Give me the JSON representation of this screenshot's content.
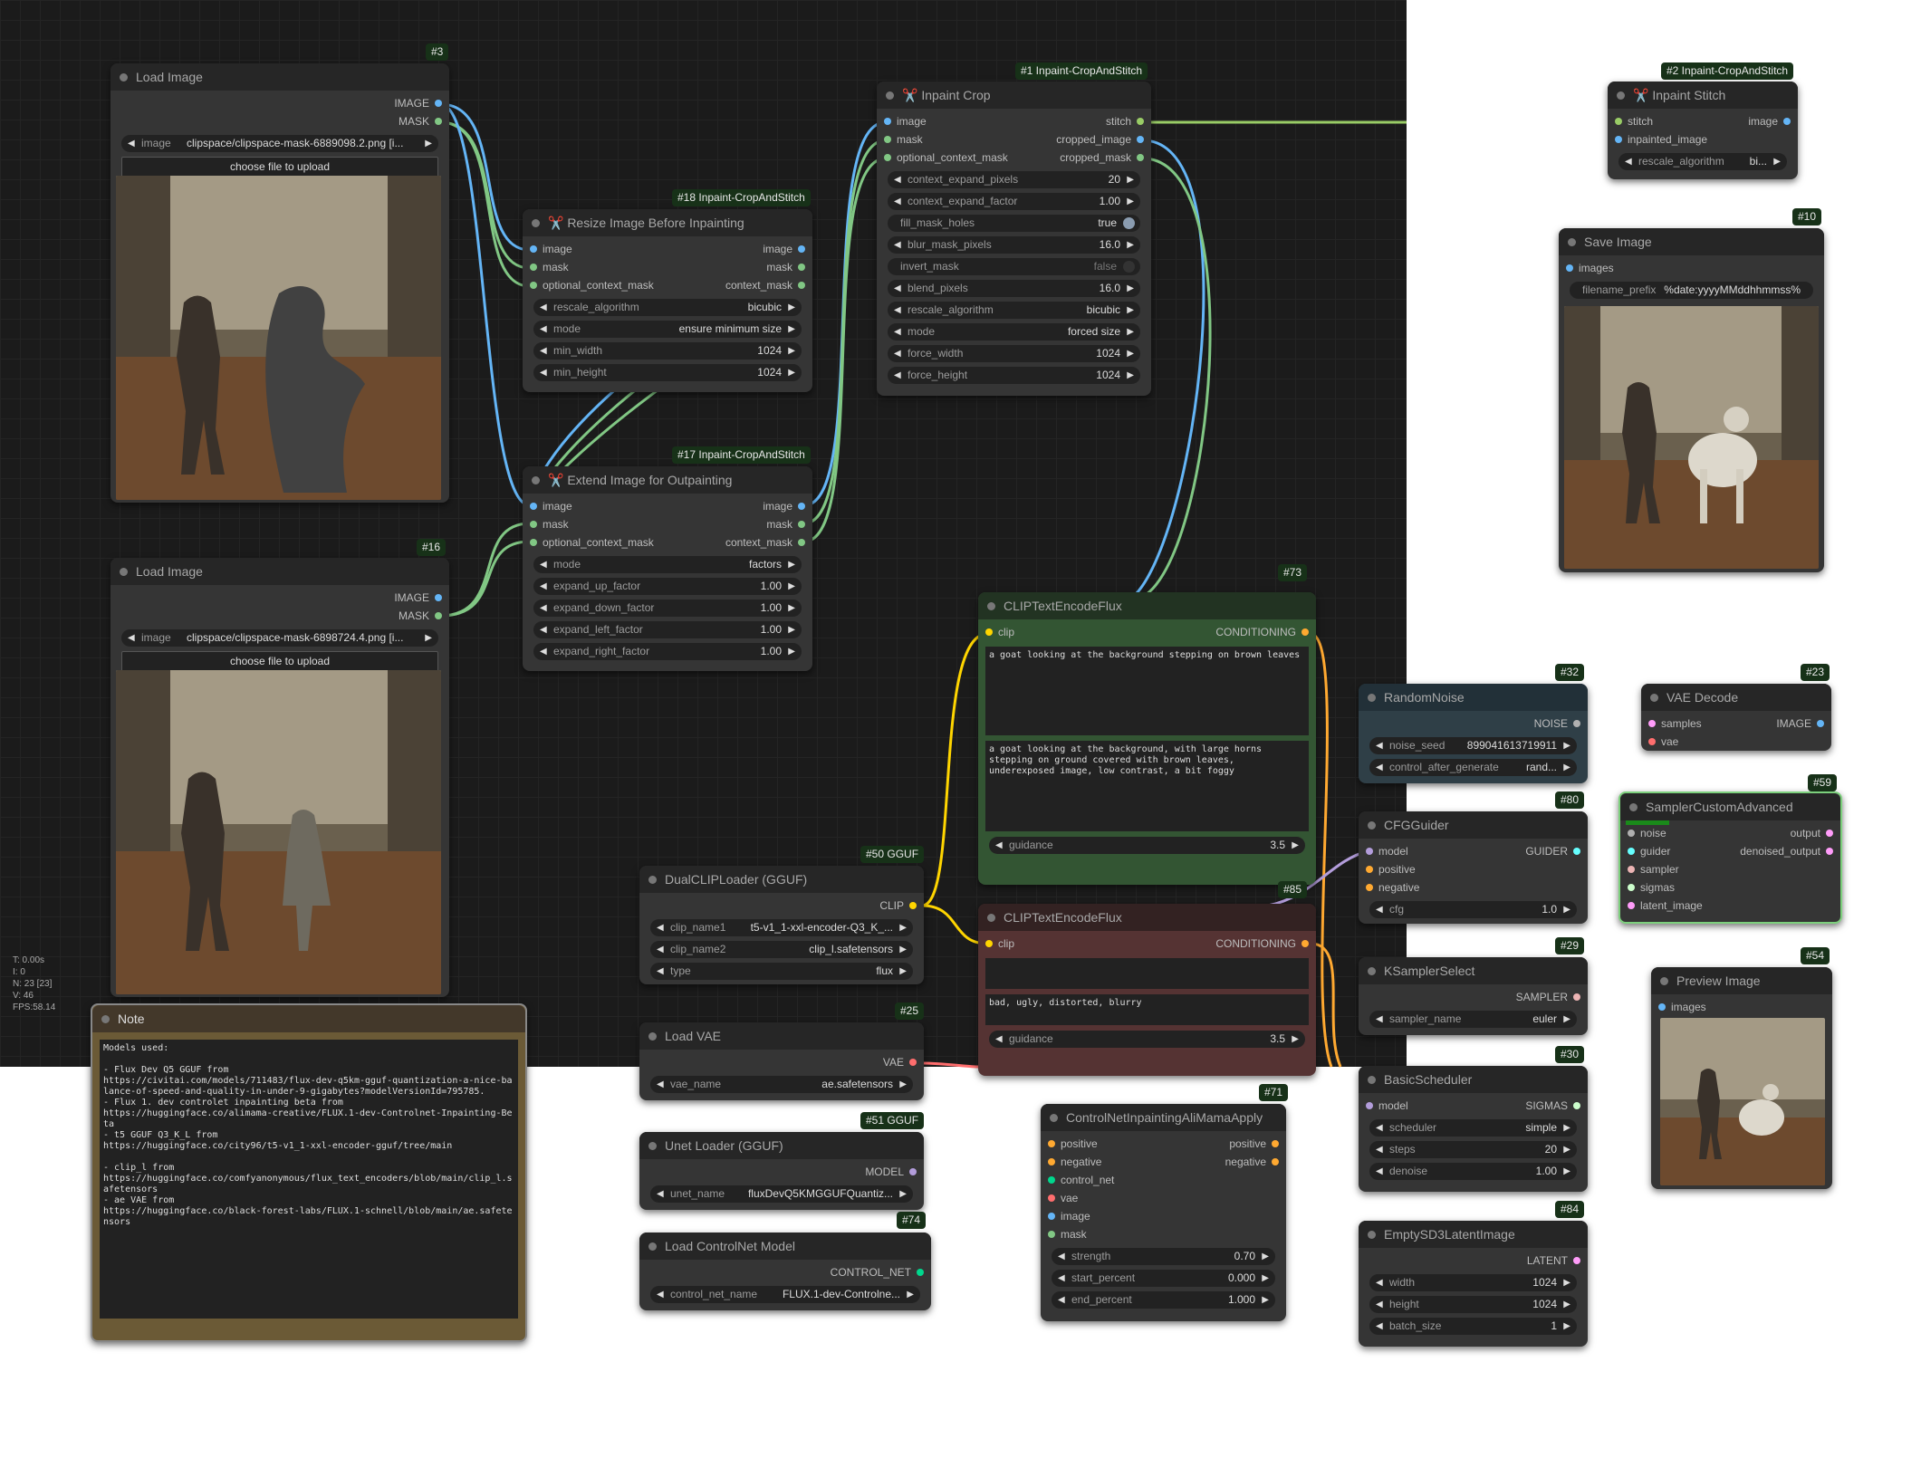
{
  "colors": {
    "image": "#64b5f6",
    "mask": "#81c784",
    "clip": "#ffd500",
    "conditioning": "#ffa931",
    "latent": "#ff9cf9",
    "vae": "#ff6e6e",
    "model": "#b39ddb",
    "control_net": "#00d78d",
    "badge_bg": "#173118"
  },
  "stats": [
    "T: 0.00s",
    "I: 0",
    "N: 23 [23]",
    "V: 46",
    "FPS:58.14"
  ],
  "nodes": {
    "load_image_3": {
      "badge": "#3",
      "title": "Load Image",
      "out1": "IMAGE",
      "out2": "MASK",
      "image_label": "image",
      "image_value": "clipspace/clipspace-mask-6889098.2.png [i...",
      "button": "choose file to upload"
    },
    "load_image_16": {
      "badge": "#16",
      "title": "Load Image",
      "out1": "IMAGE",
      "out2": "MASK",
      "image_label": "image",
      "image_value": "clipspace/clipspace-mask-6898724.4.png [i...",
      "button": "choose file to upload"
    },
    "resize_18": {
      "badge": "#18 Inpaint-CropAndStitch",
      "title": "✂️ Resize Image Before Inpainting",
      "in1": "image",
      "in2": "mask",
      "in3": "optional_context_mask",
      "out1": "image",
      "out2": "mask",
      "out3": "context_mask",
      "w1l": "rescale_algorithm",
      "w1v": "bicubic",
      "w2l": "mode",
      "w2v": "ensure minimum size",
      "w3l": "min_width",
      "w3v": "1024",
      "w4l": "min_height",
      "w4v": "1024"
    },
    "extend_17": {
      "badge": "#17 Inpaint-CropAndStitch",
      "title": "✂️ Extend Image for Outpainting",
      "in1": "image",
      "in2": "mask",
      "in3": "optional_context_mask",
      "out1": "image",
      "out2": "mask",
      "out3": "context_mask",
      "w1l": "mode",
      "w1v": "factors",
      "w2l": "expand_up_factor",
      "w2v": "1.00",
      "w3l": "expand_down_factor",
      "w3v": "1.00",
      "w4l": "expand_left_factor",
      "w4v": "1.00",
      "w5l": "expand_right_factor",
      "w5v": "1.00"
    },
    "crop_1": {
      "badge": "#1 Inpaint-CropAndStitch",
      "title": "✂️ Inpaint Crop",
      "in1": "image",
      "in2": "mask",
      "in3": "optional_context_mask",
      "out1": "stitch",
      "out2": "cropped_image",
      "out3": "cropped_mask",
      "w1l": "context_expand_pixels",
      "w1v": "20",
      "w2l": "context_expand_factor",
      "w2v": "1.00",
      "w3l": "fill_mask_holes",
      "w3v": "true",
      "w4l": "blur_mask_pixels",
      "w4v": "16.0",
      "w5l": "invert_mask",
      "w5v": "false",
      "w6l": "blend_pixels",
      "w6v": "16.0",
      "w7l": "rescale_algorithm",
      "w7v": "bicubic",
      "w8l": "mode",
      "w8v": "forced size",
      "w9l": "force_width",
      "w9v": "1024",
      "w10l": "force_height",
      "w10v": "1024"
    },
    "stitch_2": {
      "badge": "#2 Inpaint-CropAndStitch",
      "title": "✂️ Inpaint Stitch",
      "in1": "stitch",
      "in2": "inpainted_image",
      "out1": "image",
      "w1l": "rescale_algorithm",
      "w1v": "bi..."
    },
    "save_10": {
      "badge": "#10",
      "title": "Save Image",
      "in1": "images",
      "w1l": "filename_prefix",
      "w1v": "%date:yyyyMMddhhmmss%"
    },
    "clip_73": {
      "badge": "#73",
      "title": "CLIPTextEncodeFlux",
      "in1": "clip",
      "out1": "CONDITIONING",
      "text1": "a goat looking at the background stepping on brown leaves",
      "text2": "a goat looking at the background, with large horns stepping on ground covered with brown leaves, underexposed image, low contrast, a bit foggy",
      "w1l": "guidance",
      "w1v": "3.5"
    },
    "clip_85": {
      "badge": "#85",
      "title": "CLIPTextEncodeFlux",
      "in1": "clip",
      "out1": "CONDITIONING",
      "text1": "",
      "text2": "bad, ugly, distorted, blurry",
      "w1l": "guidance",
      "w1v": "3.5"
    },
    "dualclip_50": {
      "badge": "#50 GGUF",
      "title": "DualCLIPLoader (GGUF)",
      "out1": "CLIP",
      "w1l": "clip_name1",
      "w1v": "t5-v1_1-xxl-encoder-Q3_K_...",
      "w2l": "clip_name2",
      "w2v": "clip_l.safetensors",
      "w3l": "type",
      "w3v": "flux"
    },
    "vae_25": {
      "badge": "#25",
      "title": "Load VAE",
      "out1": "VAE",
      "w1l": "vae_name",
      "w1v": "ae.safetensors"
    },
    "unet_51": {
      "badge": "#51 GGUF",
      "title": "Unet Loader (GGUF)",
      "out1": "MODEL",
      "w1l": "unet_name",
      "w1v": "fluxDevQ5KMGGUFQuantiz..."
    },
    "cnloader_74": {
      "badge": "#74",
      "title": "Load ControlNet Model",
      "out1": "CONTROL_NET",
      "w1l": "control_net_name",
      "w1v": "FLUX.1-dev-Controlne..."
    },
    "cnapply_71": {
      "badge": "#71",
      "title": "ControlNetInpaintingAliMamaApply",
      "in1": "positive",
      "in2": "negative",
      "in3": "control_net",
      "in4": "vae",
      "in5": "image",
      "in6": "mask",
      "out1": "positive",
      "out2": "negative",
      "w1l": "strength",
      "w1v": "0.70",
      "w2l": "start_percent",
      "w2v": "0.000",
      "w3l": "end_percent",
      "w3v": "1.000"
    },
    "noise_32": {
      "badge": "#32",
      "title": "RandomNoise",
      "out1": "NOISE",
      "w1l": "noise_seed",
      "w1v": "899041613719911",
      "w2l": "control_after_generate",
      "w2v": "rand..."
    },
    "cfg_80": {
      "badge": "#80",
      "title": "CFGGuider",
      "in1": "model",
      "in2": "positive",
      "in3": "negative",
      "out1": "GUIDER",
      "w1l": "cfg",
      "w1v": "1.0"
    },
    "ksampler_29": {
      "badge": "#29",
      "title": "KSamplerSelect",
      "out1": "SAMPLER",
      "w1l": "sampler_name",
      "w1v": "euler"
    },
    "sched_30": {
      "badge": "#30",
      "title": "BasicScheduler",
      "in1": "model",
      "out1": "SIGMAS",
      "w1l": "scheduler",
      "w1v": "simple",
      "w2l": "steps",
      "w2v": "20",
      "w3l": "denoise",
      "w3v": "1.00"
    },
    "latent_84": {
      "badge": "#84",
      "title": "EmptySD3LatentImage",
      "out1": "LATENT",
      "w1l": "width",
      "w1v": "1024",
      "w2l": "height",
      "w2v": "1024",
      "w3l": "batch_size",
      "w3v": "1"
    },
    "vaedecode_23": {
      "badge": "#23",
      "title": "VAE Decode",
      "in1": "samples",
      "in2": "vae",
      "out1": "IMAGE"
    },
    "sca_59": {
      "badge": "#59",
      "title": "SamplerCustomAdvanced",
      "in1": "noise",
      "in2": "guider",
      "in3": "sampler",
      "in4": "sigmas",
      "in5": "latent_image",
      "out1": "output",
      "out2": "denoised_output"
    },
    "preview_54": {
      "badge": "#54",
      "title": "Preview Image",
      "in1": "images"
    },
    "note": {
      "title": "Note",
      "text": "Models used:\n\n- Flux Dev Q5 GGUF from\nhttps://civitai.com/models/711483/flux-dev-q5km-gguf-quantization-a-nice-balance-of-speed-and-quality-in-under-9-gigabytes?modelVersionId=795785.\n- Flux 1. dev controlet inpainting beta from\nhttps://huggingface.co/alimama-creative/FLUX.1-dev-Controlnet-Inpainting-Beta\n- t5 GGUF Q3_K_L from\nhttps://huggingface.co/city96/t5-v1_1-xxl-encoder-gguf/tree/main\n\n- clip_l from\nhttps://huggingface.co/comfyanonymous/flux_text_encoders/blob/main/clip_l.safetensors\n- ae VAE from\nhttps://huggingface.co/black-forest-labs/FLUX.1-schnell/blob/main/ae.safetensors"
    }
  }
}
